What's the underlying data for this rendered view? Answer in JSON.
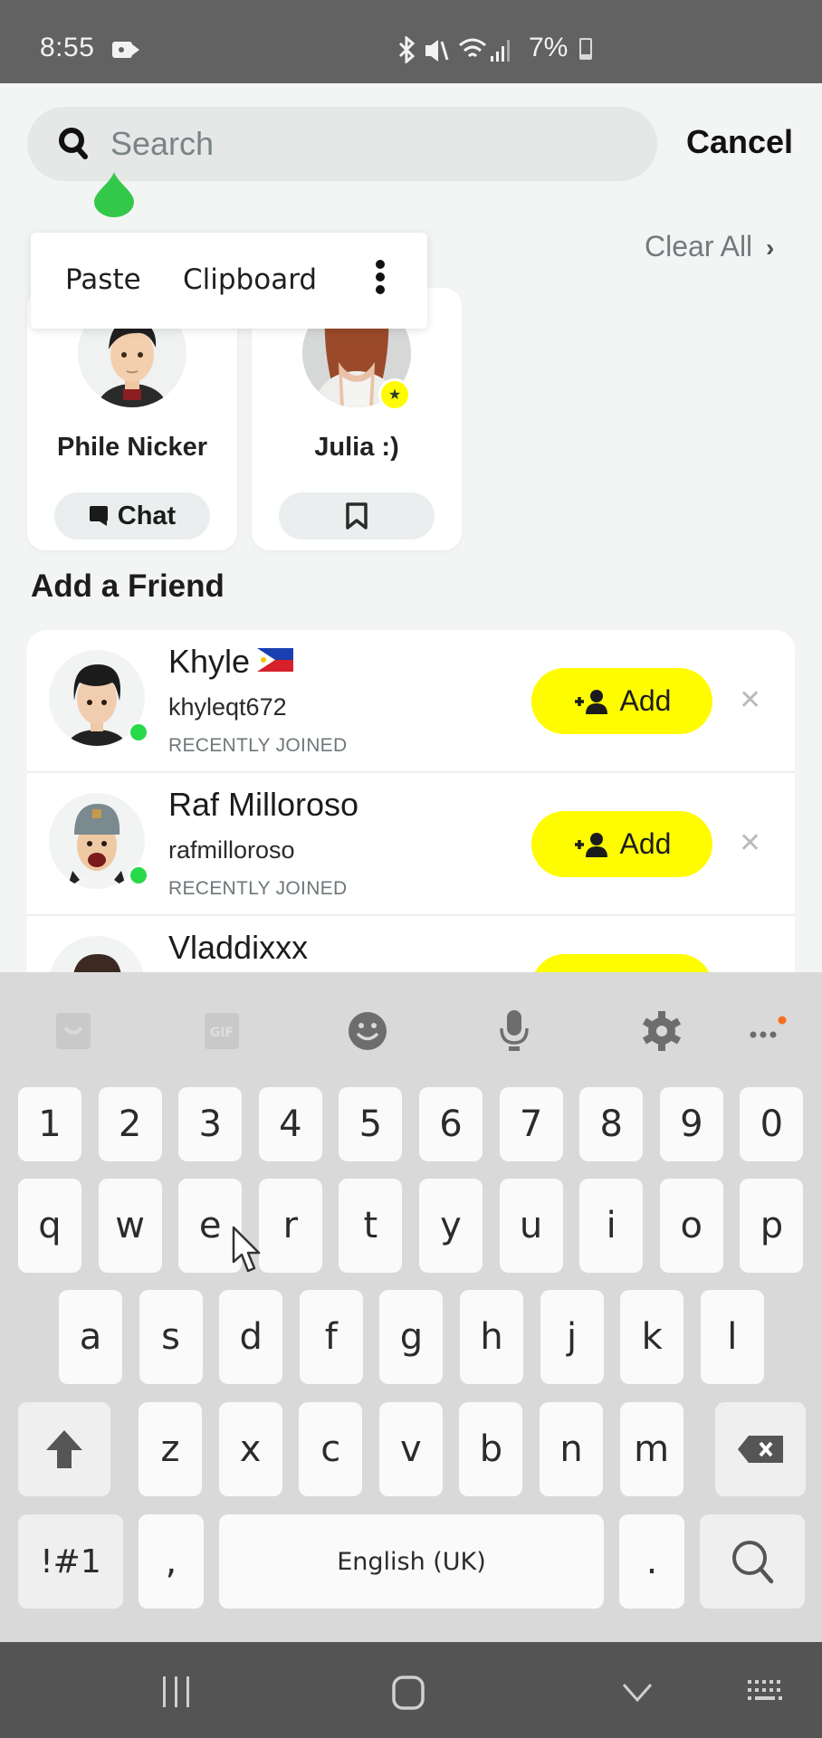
{
  "status_bar": {
    "time": "8:55",
    "battery": "7%",
    "icons": [
      "video-camera-icon",
      "bluetooth-icon",
      "mute-icon",
      "wifi-icon",
      "signal-icon",
      "battery-charging-icon"
    ]
  },
  "header": {
    "search_placeholder": "Search",
    "search_value": "",
    "cancel_label": "Cancel"
  },
  "text_popup": {
    "paste_label": "Paste",
    "clipboard_label": "Clipboard"
  },
  "recents": {
    "clear_all_label": "Clear All",
    "cards": [
      {
        "name": "Phile Nicker",
        "button_label": "Chat",
        "button_icon": "chat-icon"
      },
      {
        "name": "Julia :)",
        "button_label": "",
        "button_icon": "bookmark-icon",
        "badge": "star"
      }
    ]
  },
  "add_friend": {
    "title": "Add a Friend",
    "add_label": "Add",
    "rows": [
      {
        "name": "Khyle",
        "flag": "Philippines",
        "username": "khyleqt672",
        "status": "RECENTLY JOINED",
        "online": true
      },
      {
        "name": "Raf Milloroso",
        "username": "rafmilloroso",
        "status": "RECENTLY JOINED",
        "online": true
      },
      {
        "name": "Vladdixxx",
        "username": "",
        "status": "",
        "online": false
      }
    ]
  },
  "keyboard": {
    "toolbar": [
      "sticker-icon",
      "gif-icon",
      "emoji-icon",
      "microphone-icon",
      "settings-icon",
      "more-icon"
    ],
    "row1": [
      "1",
      "2",
      "3",
      "4",
      "5",
      "6",
      "7",
      "8",
      "9",
      "0"
    ],
    "row2": [
      "q",
      "w",
      "e",
      "r",
      "t",
      "y",
      "u",
      "i",
      "o",
      "p"
    ],
    "row3": [
      "a",
      "s",
      "d",
      "f",
      "g",
      "h",
      "j",
      "k",
      "l"
    ],
    "row4": [
      "z",
      "x",
      "c",
      "v",
      "b",
      "n",
      "m"
    ],
    "symbols_label": "!#1",
    "comma_label": ",",
    "space_label": "English (UK)",
    "period_label": "."
  },
  "colors": {
    "snap_yellow": "#fffc00",
    "online_green": "#28d94a",
    "notification_orange": "#f36f21"
  }
}
